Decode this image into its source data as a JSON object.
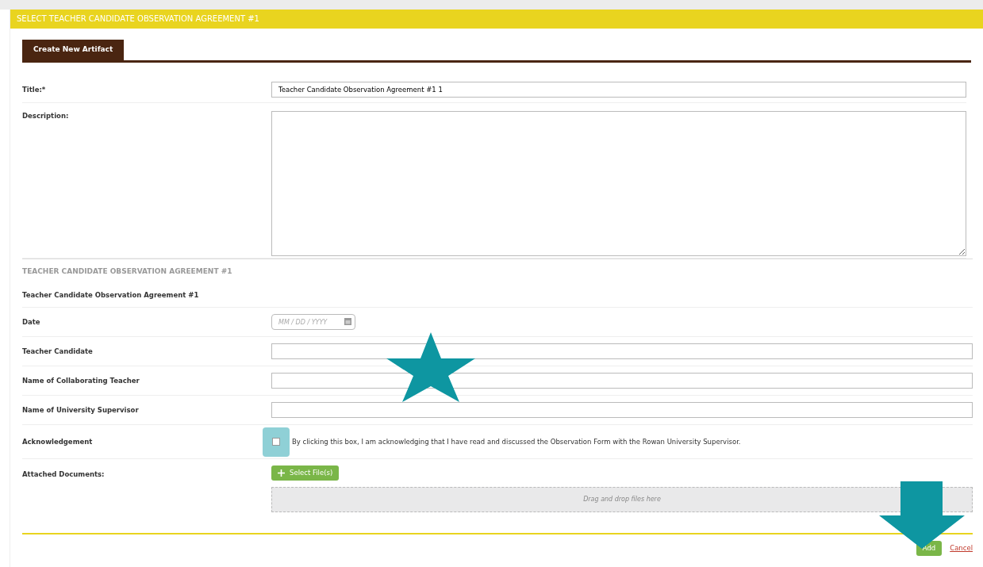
{
  "header": {
    "title": "SELECT TEACHER CANDIDATE OBSERVATION AGREEMENT #1"
  },
  "tabs": [
    {
      "label": "Create New Artifact",
      "selected": true
    }
  ],
  "rows": [
    {
      "kind": "text",
      "label": "Title:*",
      "value": "Teacher Candidate Observation Agreement #1 1"
    },
    {
      "kind": "textarea",
      "label": "Description:"
    },
    {
      "kind": "heading",
      "label": "TEACHER CANDIDATE OBSERVATION AGREEMENT #1"
    },
    {
      "kind": "subheading",
      "label": "Teacher Candidate Observation Agreement #1"
    },
    {
      "kind": "date",
      "label": "Date",
      "placeholder": "MM / DD / YYYY"
    },
    {
      "kind": "text",
      "label": "Teacher Candidate"
    },
    {
      "kind": "text",
      "label": "Name of Collaborating Teacher"
    },
    {
      "kind": "text",
      "label": "Name of University Supervisor"
    },
    {
      "kind": "checkbox",
      "label": "Acknowledgement",
      "checked": false,
      "text": "By clicking this box, I am acknowledging that I have read and discussed the Observation Form with the Rowan University Supervisor."
    },
    {
      "kind": "files",
      "label": "Attached Documents:",
      "button": "Select File(s)",
      "drop_text": "Drag and drop files here"
    }
  ],
  "actions": {
    "primary": "Add",
    "cancel": "Cancel"
  }
}
